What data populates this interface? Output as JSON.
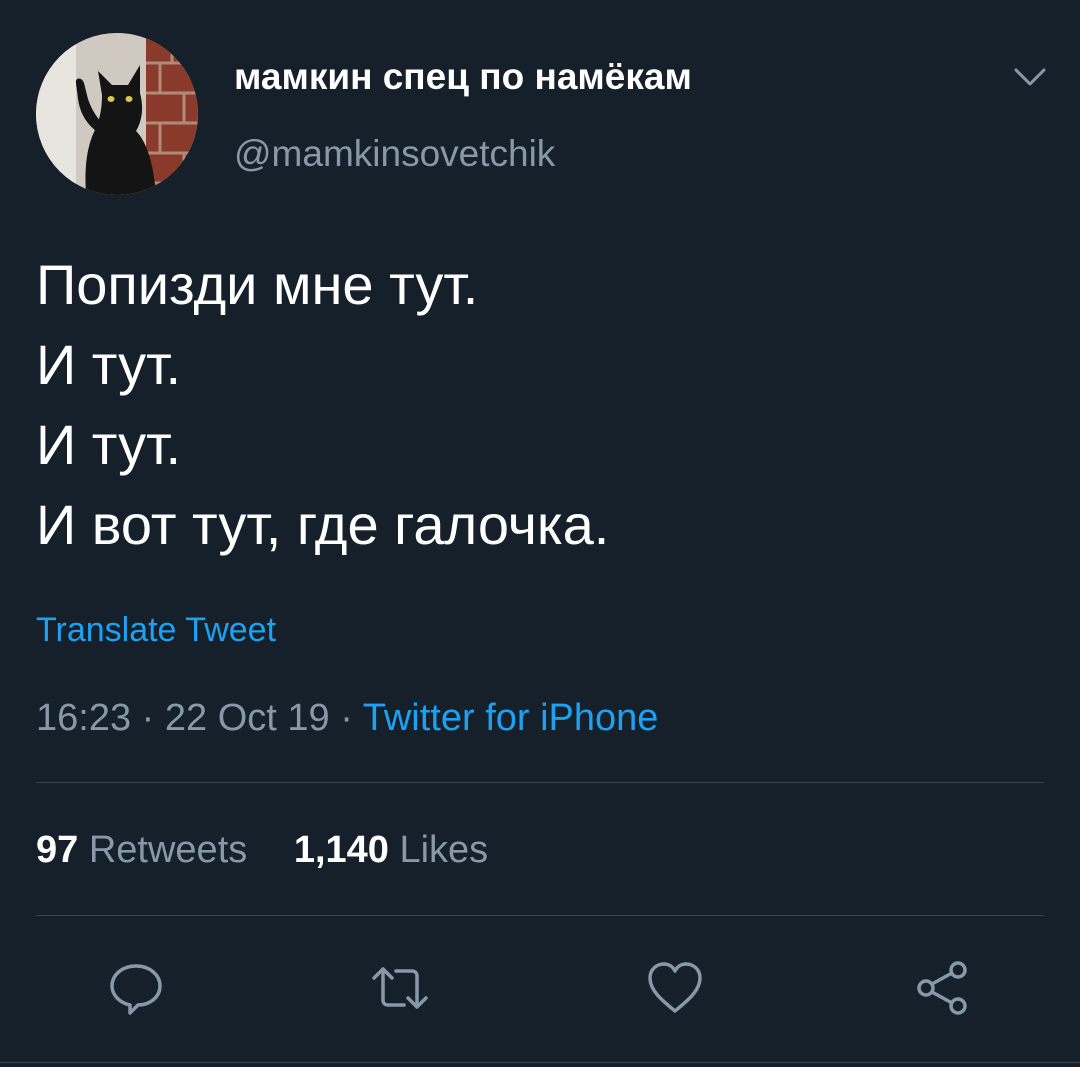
{
  "author": {
    "display_name": "мамкин спец по намёкам",
    "handle": "@mamkinsovetchik",
    "avatar_icon": "black-cat-avatar"
  },
  "tweet": {
    "lines": [
      "Попизди мне тут.",
      "И тут.",
      "И тут.",
      "И вот тут, где галочка."
    ],
    "translate_label": "Translate Tweet",
    "time": "16:23",
    "date": "22 Oct 19",
    "separator": " · ",
    "source": "Twitter for iPhone"
  },
  "stats": {
    "retweets_count": "97",
    "retweets_label": "Retweets",
    "likes_count": "1,140",
    "likes_label": "Likes"
  },
  "actions": {
    "reply_icon": "reply-icon",
    "retweet_icon": "retweet-icon",
    "like_icon": "heart-icon",
    "share_icon": "share-icon"
  },
  "colors": {
    "background": "#15202b",
    "primary_text": "#ffffff",
    "secondary_text": "#8899a6",
    "accent": "#1da1f2",
    "divider": "#38444d"
  }
}
